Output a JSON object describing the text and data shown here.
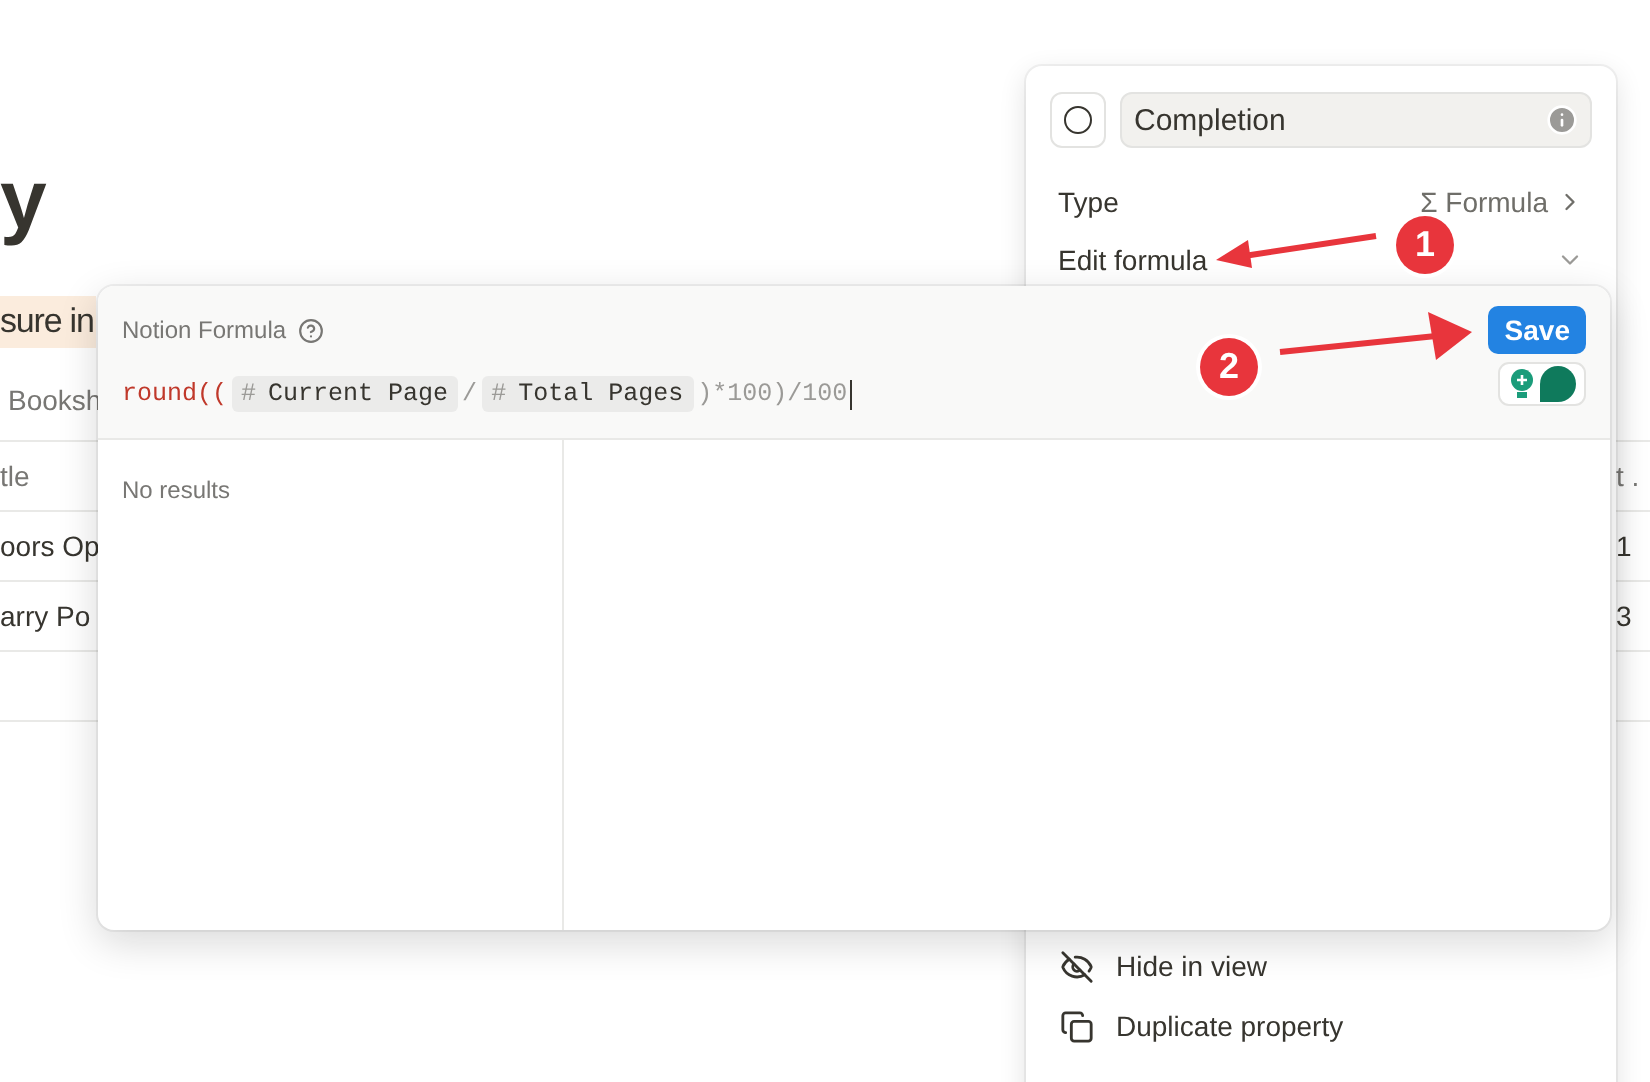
{
  "page": {
    "title": "y",
    "highlight": "sure in",
    "view_tab": "Booksh",
    "table": {
      "header_left": "tle",
      "header_right": "t .",
      "rows": [
        {
          "title": "oors Op",
          "value": "1"
        },
        {
          "title": "arry Po",
          "value": "3"
        }
      ]
    }
  },
  "property_panel": {
    "name": "Completion",
    "rows": [
      {
        "kind": "type",
        "label": "Type",
        "icon": "Σ",
        "value": "Formula"
      },
      {
        "kind": "edit",
        "label": "Edit formula"
      }
    ],
    "menu": [
      {
        "kind": "hide",
        "label": "Hide in view"
      },
      {
        "kind": "duplicate",
        "label": "Duplicate property"
      }
    ]
  },
  "formula_dialog": {
    "title": "Notion Formula",
    "formula": [
      {
        "kind": "fn",
        "text": "round(("
      },
      {
        "kind": "prop",
        "icon": "#",
        "text": "Current Page"
      },
      {
        "kind": "op",
        "text": "/"
      },
      {
        "kind": "prop",
        "icon": "#",
        "text": "Total Pages"
      },
      {
        "kind": "op",
        "text": ")*100)/100"
      }
    ],
    "save": "Save",
    "results": "No results"
  },
  "annotations": [
    {
      "number": "1"
    },
    {
      "number": "2"
    }
  ]
}
